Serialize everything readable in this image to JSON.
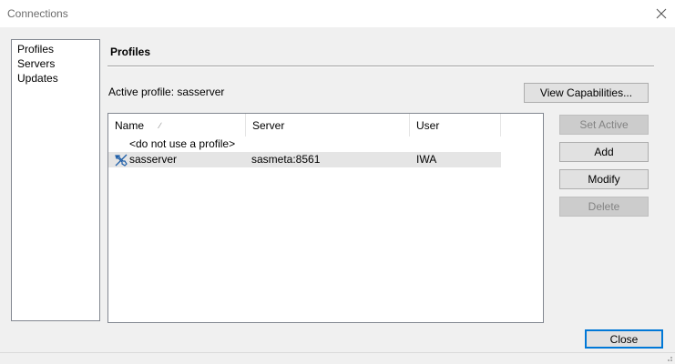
{
  "window": {
    "title": "Connections",
    "close_icon": "close-icon"
  },
  "nav": {
    "items": [
      {
        "label": "Profiles"
      },
      {
        "label": "Servers"
      },
      {
        "label": "Updates"
      }
    ]
  },
  "profiles": {
    "section_title": "Profiles",
    "active_profile_text": "Active profile: sasserver",
    "view_capabilities_label": "View Capabilities...",
    "columns": {
      "name": "Name",
      "server": "Server",
      "user": "User"
    },
    "rows": [
      {
        "name": "<do not use a profile>",
        "server": "",
        "user": "",
        "icon": "",
        "selected": false
      },
      {
        "name": "sasserver",
        "server": "sasmeta:8561",
        "user": "IWA",
        "icon": "connection-plug-icon",
        "selected": true
      }
    ]
  },
  "actions": {
    "set_active_label": "Set Active",
    "add_label": "Add",
    "modify_label": "Modify",
    "delete_label": "Delete",
    "close_label": "Close"
  },
  "colors": {
    "accent": "#0078d7",
    "selection": "#e5e5e5",
    "disabled_text": "#838383",
    "window_bg": "#f0f0f0"
  }
}
